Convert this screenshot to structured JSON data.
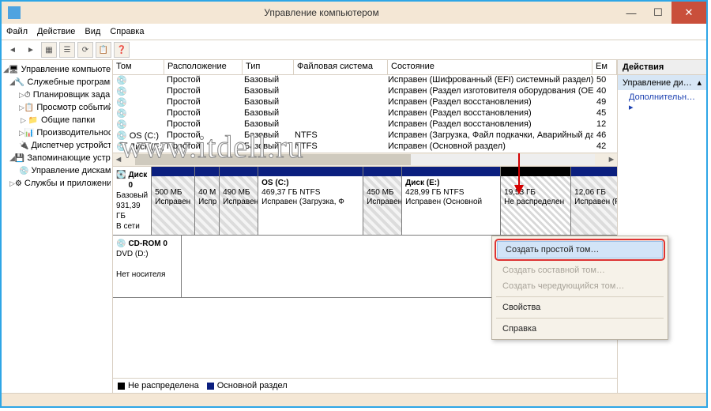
{
  "window": {
    "title": "Управление компьютером"
  },
  "menu": {
    "file": "Файл",
    "action": "Действие",
    "view": "Вид",
    "help": "Справка"
  },
  "tree": {
    "root": "Управление компьютером (",
    "n1": "Служебные программы",
    "n1a": "Планировщик заданий",
    "n1b": "Просмотр событий",
    "n1c": "Общие папки",
    "n1d": "Производительность",
    "n1e": "Диспетчер устройств",
    "n2": "Запоминающие устройст",
    "n2a": "Управление дисками",
    "n3": "Службы и приложения"
  },
  "cols": {
    "vol": "Том",
    "layout": "Расположение",
    "type": "Тип",
    "fs": "Файловая система",
    "status": "Состояние",
    "cap": "Ем"
  },
  "rows": [
    {
      "vol": "",
      "layout": "Простой",
      "type": "Базовый",
      "fs": "",
      "status": "Исправен (Шифрованный (EFI) системный раздел)",
      "cap": "50"
    },
    {
      "vol": "",
      "layout": "Простой",
      "type": "Базовый",
      "fs": "",
      "status": "Исправен (Раздел изготовителя оборудования (OEM))",
      "cap": "40"
    },
    {
      "vol": "",
      "layout": "Простой",
      "type": "Базовый",
      "fs": "",
      "status": "Исправен (Раздел восстановления)",
      "cap": "49"
    },
    {
      "vol": "",
      "layout": "Простой",
      "type": "Базовый",
      "fs": "",
      "status": "Исправен (Раздел восстановления)",
      "cap": "45"
    },
    {
      "vol": "",
      "layout": "Простой",
      "type": "Базовый",
      "fs": "",
      "status": "Исправен (Раздел восстановления)",
      "cap": "12"
    },
    {
      "vol": "OS (C:)",
      "layout": "Простой",
      "type": "Базовый",
      "fs": "NTFS",
      "status": "Исправен (Загрузка, Файл подкачки, Аварийный дамп памяти, Основной раздел)",
      "cap": "46"
    },
    {
      "vol": "Диск (E:)",
      "layout": "Простой",
      "type": "Базовый",
      "fs": "NTFS",
      "status": "Исправен (Основной раздел)",
      "cap": "42"
    }
  ],
  "watermark": "www.itdell.ru",
  "disk0": {
    "name": "Диск 0",
    "type": "Базовый",
    "size": "931,39 ГБ",
    "state": "В сети",
    "p1": {
      "l1": "500 МБ",
      "l2": "Исправен"
    },
    "p2": {
      "l1": "40 М",
      "l2": "Испр"
    },
    "p3": {
      "l1": "490 МБ",
      "l2": "Исправен"
    },
    "p4": {
      "t": "OS  (C:)",
      "l1": "469,37 ГБ NTFS",
      "l2": "Исправен (Загрузка, Ф"
    },
    "p5": {
      "l1": "450 МБ",
      "l2": "Исправен"
    },
    "p6": {
      "t": "Диск  (E:)",
      "l1": "428,99 ГБ NTFS",
      "l2": "Исправен (Основной"
    },
    "p7": {
      "l1": "19,53 ГБ",
      "l2": "Не распределен"
    },
    "p8": {
      "l1": "12,06 ГБ",
      "l2": "Исправен (Разд"
    }
  },
  "cdrom": {
    "name": "CD-ROM 0",
    "type": "DVD (D:)",
    "state": "Нет носителя"
  },
  "legend": {
    "unalloc": "Не распределена",
    "primary": "Основной раздел"
  },
  "actions": {
    "hd": "Действия",
    "link": "Управление ди…",
    "more": "Дополнительн…"
  },
  "ctx": {
    "create_simple": "Создать простой том…",
    "create_spanned": "Создать составной том…",
    "create_striped": "Создать чередующийся том…",
    "props": "Свойства",
    "help": "Справка"
  }
}
